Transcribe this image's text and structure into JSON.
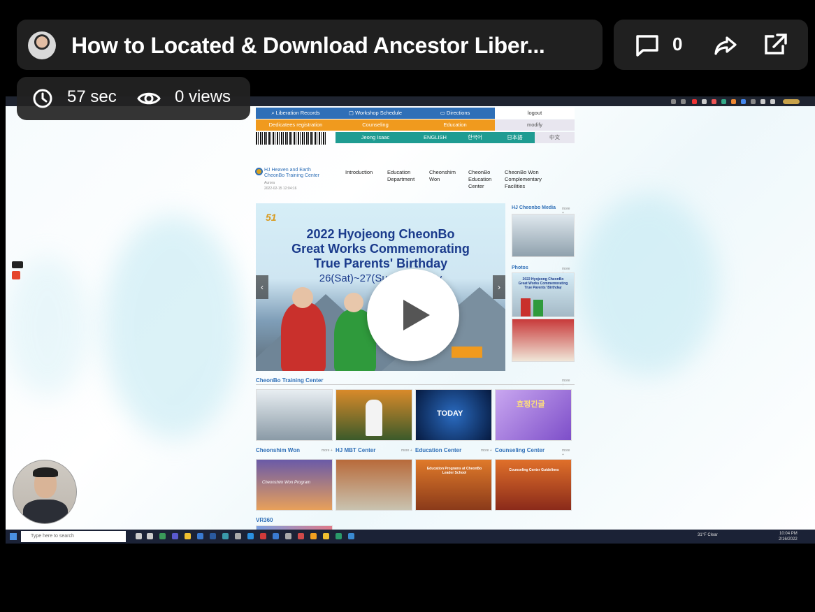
{
  "video": {
    "title": "How to Located & Download Ancestor Liber...",
    "comments": "0",
    "duration": "57 sec",
    "views": "0 views"
  },
  "webpage": {
    "nav_row1": [
      "Liberation Records",
      "Workshop Schedule",
      "Directions",
      "logout"
    ],
    "nav_row2": [
      "Dedicatees registration",
      "Counseling",
      "Education",
      "modify"
    ],
    "nav_row3": [
      "Jeong Isaac",
      "ENGLISH",
      "한국어",
      "日本語",
      "中文"
    ],
    "logo": {
      "line1": "HJ Heaven and Earth",
      "line2": "CheonBo Training Center",
      "line3": "Aurora",
      "line4": "2022-02-15 12:04:16"
    },
    "menu": [
      "Introduction",
      "Education Department",
      "Cheonshim Won",
      "CheonBo Education Center",
      "CheonBo Won Complementary Facilities"
    ],
    "banner": {
      "badge": "51",
      "title1": "2022 Hyojeong CheonBo",
      "title2": "Great Works Commemorating",
      "title3": "True Parents' Birthday",
      "dates": "26(Sat)~27(Sun) February"
    },
    "side": {
      "media_title": "HJ Cheonbo Media",
      "photos_title": "Photos",
      "more": "more +",
      "photo_caption1": "2022 Hyojeong CheonBo",
      "photo_caption2": "Great Works Commemorating",
      "photo_caption3": "True Parents' Birthday"
    },
    "sections": {
      "training_center": "CheonBo Training Center",
      "cheonshim": "Cheonshim Won",
      "mbt": "HJ MBT Center",
      "education": "Education Center",
      "counseling": "Counseling Center",
      "vr": "VR360",
      "more": "more +",
      "thumb_today": "TODAY",
      "thumb_korean": "효정긴글",
      "thumb_cheonshim": "Cheonshim Won Program",
      "thumb_edu": "Education Programs at CheonBo Leader School",
      "thumb_counsel": "Counseling Center Guidelines"
    }
  },
  "taskbar": {
    "search_placeholder": "Type here to search",
    "weather": "31°F Clear",
    "time": "10:04 PM",
    "date": "2/16/2022"
  },
  "colors": {
    "overlay": "#232323",
    "nav_blue": "#2f6fb7",
    "nav_orange": "#f09a1e",
    "nav_teal": "#1f9c92",
    "title_blue": "#1b3b8c"
  }
}
